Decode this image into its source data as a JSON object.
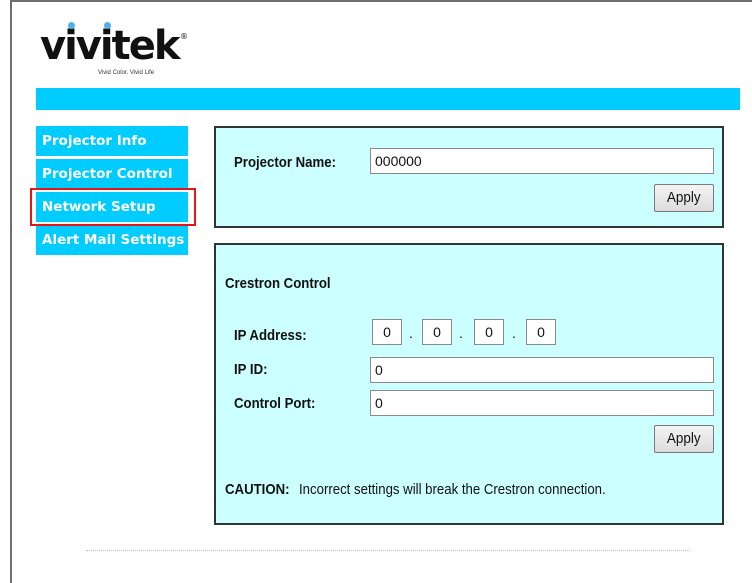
{
  "brand": {
    "logo_text": "vivitek",
    "registered_mark": "®",
    "tagline": "Vivid Color. Vivid Life",
    "colors": {
      "accent": "#00ccff",
      "panel_bg": "#ccffff",
      "highlight": "#e01818"
    }
  },
  "nav": {
    "items": [
      {
        "label": "Projector Info"
      },
      {
        "label": "Projector Control"
      },
      {
        "label": "Network Setup",
        "highlighted": true
      },
      {
        "label": "Alert Mail Settings"
      }
    ]
  },
  "projector_name_panel": {
    "label": "Projector Name:",
    "value": "000000",
    "apply_label": "Apply"
  },
  "crestron_panel": {
    "title": "Crestron Control",
    "ip_address_label": "IP Address:",
    "ip_octets": [
      "0",
      "0",
      "0",
      "0"
    ],
    "ip_separator": ".",
    "ip_id_label": "IP ID:",
    "ip_id_value": "0",
    "control_port_label": "Control Port:",
    "control_port_value": "0",
    "apply_label": "Apply",
    "caution_label": "CAUTION:",
    "caution_text": "Incorrect settings will break the Crestron connection."
  }
}
